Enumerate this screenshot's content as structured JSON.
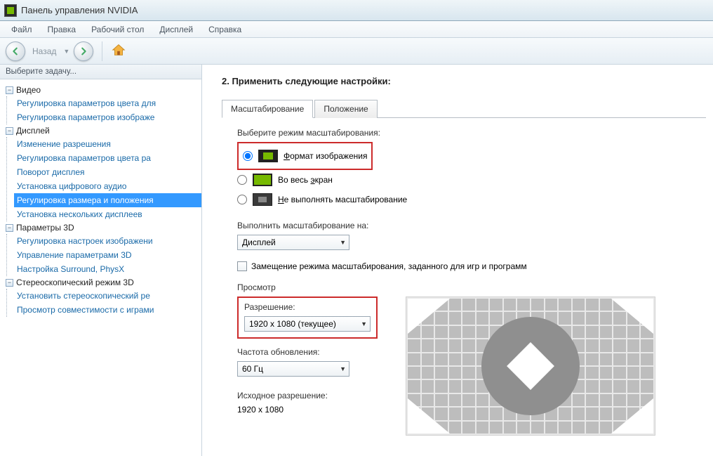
{
  "titlebar": {
    "title": "Панель управления NVIDIA"
  },
  "menubar": {
    "items": [
      "Файл",
      "Правка",
      "Рабочий стол",
      "Дисплей",
      "Справка"
    ]
  },
  "navbar": {
    "back_label": "Назад"
  },
  "sidebar": {
    "header": "Выберите задачу...",
    "cats": [
      {
        "label": "Видео",
        "items": [
          "Регулировка параметров цвета для",
          "Регулировка параметров изображе"
        ]
      },
      {
        "label": "Дисплей",
        "items": [
          "Изменение разрешения",
          "Регулировка параметров цвета ра",
          "Поворот дисплея",
          "Установка цифрового аудио",
          "Регулировка размера и положения",
          "Установка нескольких дисплеев"
        ],
        "selected_index": 4
      },
      {
        "label": "Параметры 3D",
        "items": [
          "Регулировка настроек изображени",
          "Управление параметрами 3D",
          "Настройка Surround, PhysX"
        ]
      },
      {
        "label": "Стереоскопический режим 3D",
        "items": [
          "Установить стереоскопический ре",
          "Просмотр совместимости с играми"
        ]
      }
    ]
  },
  "main": {
    "section_title": "2. Применить следующие настройки:",
    "tabs": {
      "scaling": "Масштабирование",
      "position": "Положение"
    },
    "scale_mode_label": "Выберите режим масштабирования:",
    "modes": {
      "aspect_prefix": "Ф",
      "aspect_rest": "ормат изображения",
      "full_pre": "Во весь ",
      "full_u": "э",
      "full_post": "кран",
      "none_u": "Н",
      "none_rest": "е выполнять масштабирование"
    },
    "scale_on_label": "Выполнить масштабирование на:",
    "scale_on_value": "Дисплей",
    "override_label": "Замещение режима масштабирования, заданного для игр и программ",
    "preview_label": "Просмотр",
    "resolution_label": "Разрешение:",
    "resolution_value": "1920 x 1080 (текущее)",
    "refresh_label": "Частота обновления:",
    "refresh_value": "60 Гц",
    "native_label": "Исходное разрешение:",
    "native_value": "1920 x 1080"
  }
}
